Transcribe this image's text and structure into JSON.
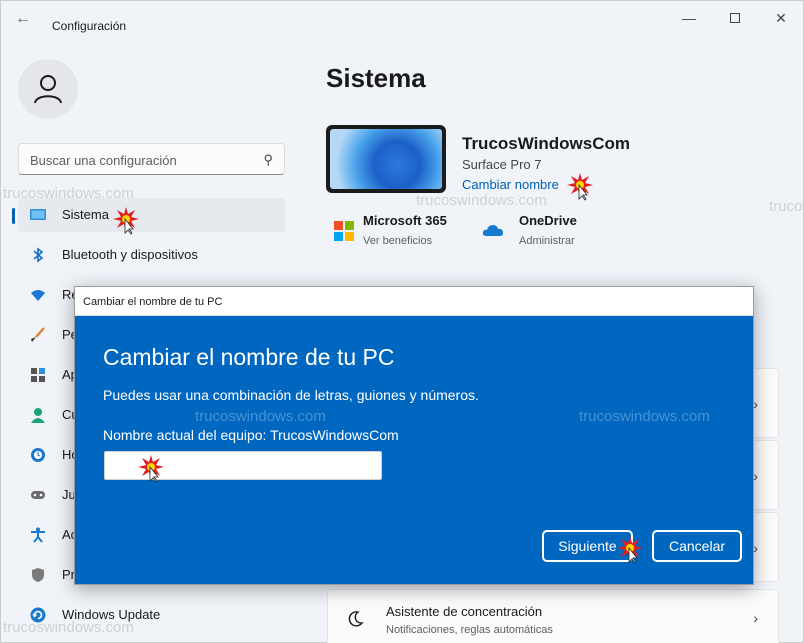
{
  "window": {
    "title": "Configuración",
    "controls": {
      "minimize": "—",
      "close": "✕"
    }
  },
  "search": {
    "placeholder": "Buscar una configuración"
  },
  "sidebar": {
    "items": [
      {
        "label": "Sistema",
        "icon": "monitor-icon",
        "active": true
      },
      {
        "label": "Bluetooth y dispositivos",
        "icon": "bluetooth-icon"
      },
      {
        "label": "Re",
        "icon": "wifi-icon"
      },
      {
        "label": "Pe",
        "icon": "brush-icon"
      },
      {
        "label": "Ap",
        "icon": "apps-icon"
      },
      {
        "label": "Cu",
        "icon": "person-icon"
      },
      {
        "label": "Ho",
        "icon": "clock-globe-icon"
      },
      {
        "label": "Ju",
        "icon": "gamepad-icon"
      },
      {
        "label": "Ac",
        "icon": "accessibility-icon"
      },
      {
        "label": "Pr",
        "icon": "shield-icon"
      },
      {
        "label": "Windows Update",
        "icon": "update-icon"
      }
    ]
  },
  "main": {
    "title": "Sistema",
    "device": {
      "name": "TrucosWindowsCom",
      "model": "Surface Pro 7",
      "rename_link": "Cambiar nombre"
    },
    "services": [
      {
        "name": "Microsoft 365",
        "sub": "Ver beneficios",
        "icon": "microsoft-logo-icon"
      },
      {
        "name": "OneDrive",
        "sub": "Administrar",
        "icon": "onedrive-icon"
      }
    ],
    "focus_card": {
      "title": "Asistente de concentración",
      "sub": "Notificaciones, reglas automáticas"
    }
  },
  "dialog": {
    "window_title": "Cambiar el nombre de tu PC",
    "heading": "Cambiar el nombre de tu PC",
    "description": "Puedes usar una combinación de letras, guiones y números.",
    "current_name_label": "Nombre actual del equipo: TrucosWindowsCom",
    "new_name_value": "",
    "next_button": "Siguiente",
    "cancel_button": "Cancelar"
  },
  "watermark": "trucoswindows.com",
  "colors": {
    "accent": "#005fb8",
    "dialog_bg": "#0067c0",
    "window_bg": "#f0f4f9"
  }
}
